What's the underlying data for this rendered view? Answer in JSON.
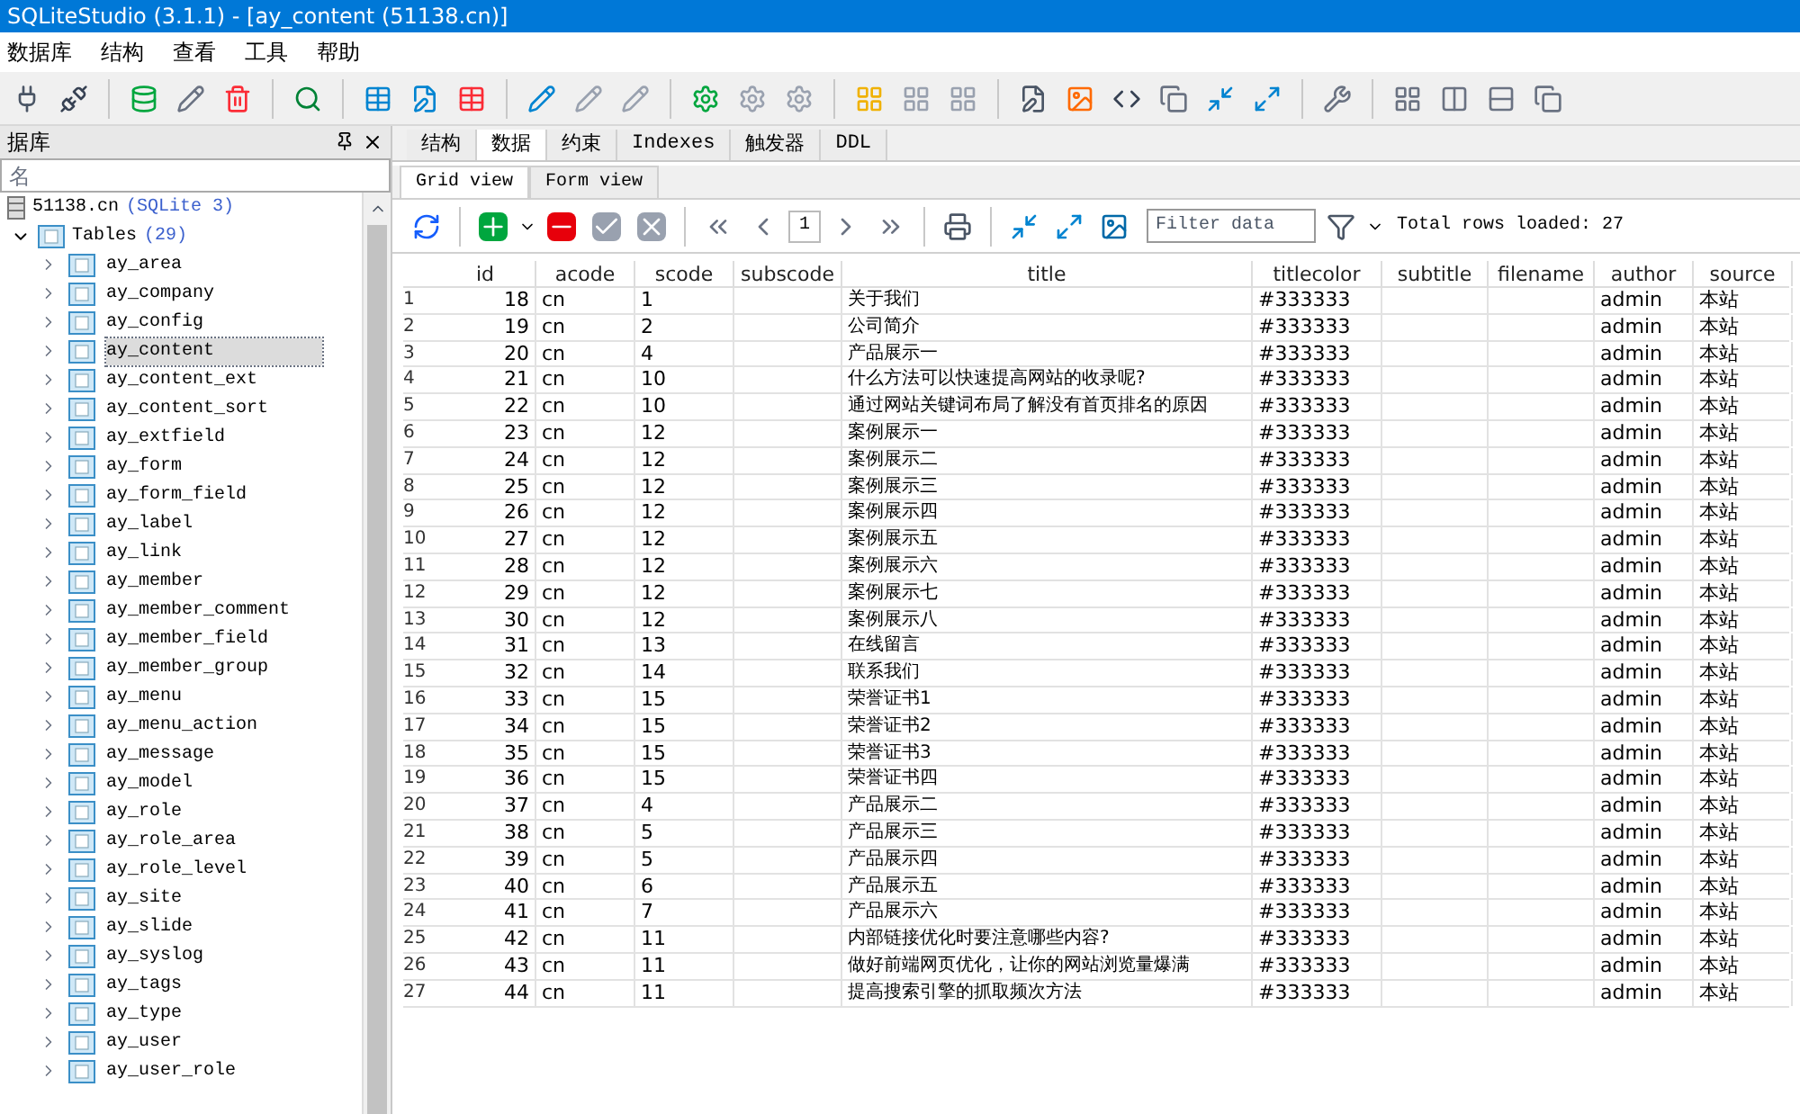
{
  "window": {
    "title": "SQLiteStudio (3.1.1) - [ay_content (51138.cn)]"
  },
  "menu": [
    "数据库",
    "结构",
    "查看",
    "工具",
    "帮助"
  ],
  "sidebar": {
    "title": "据库",
    "filter": {
      "placeholder": "名"
    },
    "database": {
      "name": "51138.cn",
      "type": "(SQLite 3)",
      "expanded": true
    },
    "tables": {
      "label": "Tables",
      "count": "(29)",
      "expanded": true,
      "items": [
        {
          "name": "ay_area",
          "selected": false
        },
        {
          "name": "ay_company",
          "selected": false
        },
        {
          "name": "ay_config",
          "selected": false
        },
        {
          "name": "ay_content",
          "selected": true
        },
        {
          "name": "ay_content_ext",
          "selected": false
        },
        {
          "name": "ay_content_sort",
          "selected": false
        },
        {
          "name": "ay_extfield",
          "selected": false
        },
        {
          "name": "ay_form",
          "selected": false
        },
        {
          "name": "ay_form_field",
          "selected": false
        },
        {
          "name": "ay_label",
          "selected": false
        },
        {
          "name": "ay_link",
          "selected": false
        },
        {
          "name": "ay_member",
          "selected": false
        },
        {
          "name": "ay_member_comment",
          "selected": false
        },
        {
          "name": "ay_member_field",
          "selected": false
        },
        {
          "name": "ay_member_group",
          "selected": false
        },
        {
          "name": "ay_menu",
          "selected": false
        },
        {
          "name": "ay_menu_action",
          "selected": false
        },
        {
          "name": "ay_message",
          "selected": false
        },
        {
          "name": "ay_model",
          "selected": false
        },
        {
          "name": "ay_role",
          "selected": false
        },
        {
          "name": "ay_role_area",
          "selected": false
        },
        {
          "name": "ay_role_level",
          "selected": false
        },
        {
          "name": "ay_site",
          "selected": false
        },
        {
          "name": "ay_slide",
          "selected": false
        },
        {
          "name": "ay_syslog",
          "selected": false
        },
        {
          "name": "ay_tags",
          "selected": false
        },
        {
          "name": "ay_type",
          "selected": false
        },
        {
          "name": "ay_user",
          "selected": false
        },
        {
          "name": "ay_user_role",
          "selected": false
        }
      ]
    }
  },
  "tabs": [
    {
      "label": "结构",
      "selected": false
    },
    {
      "label": "数据",
      "selected": true
    },
    {
      "label": "约束",
      "selected": false
    },
    {
      "label": "Indexes",
      "selected": false
    },
    {
      "label": "触发器",
      "selected": false
    },
    {
      "label": "DDL",
      "selected": false
    }
  ],
  "view_tabs": [
    {
      "label": "Grid view",
      "selected": true
    },
    {
      "label": "Form view",
      "selected": false
    }
  ],
  "data_toolbar": {
    "page": "1",
    "filter": {
      "placeholder": "Filter data"
    },
    "status": "Total rows loaded: 27"
  },
  "table": {
    "columns": [
      {
        "name": "id"
      },
      {
        "name": "acode"
      },
      {
        "name": "scode"
      },
      {
        "name": "subscode"
      },
      {
        "name": "title"
      },
      {
        "name": "titlecolor"
      },
      {
        "name": "subtitle"
      },
      {
        "name": "filename"
      },
      {
        "name": "author"
      },
      {
        "name": "source"
      }
    ],
    "rows": [
      {
        "num": "1",
        "cells": [
          "18",
          "cn",
          "1",
          "",
          "关于我们",
          "#333333",
          "",
          "",
          "admin",
          "本站"
        ]
      },
      {
        "num": "2",
        "cells": [
          "19",
          "cn",
          "2",
          "",
          "公司简介",
          "#333333",
          "",
          "",
          "admin",
          "本站"
        ]
      },
      {
        "num": "3",
        "cells": [
          "20",
          "cn",
          "4",
          "",
          "产品展示一",
          "#333333",
          "",
          "",
          "admin",
          "本站"
        ]
      },
      {
        "num": "4",
        "cells": [
          "21",
          "cn",
          "10",
          "",
          "什么方法可以快速提高网站的收录呢?",
          "#333333",
          "",
          "",
          "admin",
          "本站"
        ]
      },
      {
        "num": "5",
        "cells": [
          "22",
          "cn",
          "10",
          "",
          "通过网站关键词布局了解没有首页排名的原因",
          "#333333",
          "",
          "",
          "admin",
          "本站"
        ]
      },
      {
        "num": "6",
        "cells": [
          "23",
          "cn",
          "12",
          "",
          "案例展示一",
          "#333333",
          "",
          "",
          "admin",
          "本站"
        ]
      },
      {
        "num": "7",
        "cells": [
          "24",
          "cn",
          "12",
          "",
          "案例展示二",
          "#333333",
          "",
          "",
          "admin",
          "本站"
        ]
      },
      {
        "num": "8",
        "cells": [
          "25",
          "cn",
          "12",
          "",
          "案例展示三",
          "#333333",
          "",
          "",
          "admin",
          "本站"
        ]
      },
      {
        "num": "9",
        "cells": [
          "26",
          "cn",
          "12",
          "",
          "案例展示四",
          "#333333",
          "",
          "",
          "admin",
          "本站"
        ]
      },
      {
        "num": "10",
        "cells": [
          "27",
          "cn",
          "12",
          "",
          "案例展示五",
          "#333333",
          "",
          "",
          "admin",
          "本站"
        ]
      },
      {
        "num": "11",
        "cells": [
          "28",
          "cn",
          "12",
          "",
          "案例展示六",
          "#333333",
          "",
          "",
          "admin",
          "本站"
        ]
      },
      {
        "num": "12",
        "cells": [
          "29",
          "cn",
          "12",
          "",
          "案例展示七",
          "#333333",
          "",
          "",
          "admin",
          "本站"
        ]
      },
      {
        "num": "13",
        "cells": [
          "30",
          "cn",
          "12",
          "",
          "案例展示八",
          "#333333",
          "",
          "",
          "admin",
          "本站"
        ]
      },
      {
        "num": "14",
        "cells": [
          "31",
          "cn",
          "13",
          "",
          "在线留言",
          "#333333",
          "",
          "",
          "admin",
          "本站"
        ]
      },
      {
        "num": "15",
        "cells": [
          "32",
          "cn",
          "14",
          "",
          "联系我们",
          "#333333",
          "",
          "",
          "admin",
          "本站"
        ]
      },
      {
        "num": "16",
        "cells": [
          "33",
          "cn",
          "15",
          "",
          "荣誉证书1",
          "#333333",
          "",
          "",
          "admin",
          "本站"
        ]
      },
      {
        "num": "17",
        "cells": [
          "34",
          "cn",
          "15",
          "",
          "荣誉证书2",
          "#333333",
          "",
          "",
          "admin",
          "本站"
        ]
      },
      {
        "num": "18",
        "cells": [
          "35",
          "cn",
          "15",
          "",
          "荣誉证书3",
          "#333333",
          "",
          "",
          "admin",
          "本站"
        ]
      },
      {
        "num": "19",
        "cells": [
          "36",
          "cn",
          "15",
          "",
          "荣誉证书四",
          "#333333",
          "",
          "",
          "admin",
          "本站"
        ]
      },
      {
        "num": "20",
        "cells": [
          "37",
          "cn",
          "4",
          "",
          "产品展示二",
          "#333333",
          "",
          "",
          "admin",
          "本站"
        ]
      },
      {
        "num": "21",
        "cells": [
          "38",
          "cn",
          "5",
          "",
          "产品展示三",
          "#333333",
          "",
          "",
          "admin",
          "本站"
        ]
      },
      {
        "num": "22",
        "cells": [
          "39",
          "cn",
          "5",
          "",
          "产品展示四",
          "#333333",
          "",
          "",
          "admin",
          "本站"
        ]
      },
      {
        "num": "23",
        "cells": [
          "40",
          "cn",
          "6",
          "",
          "产品展示五",
          "#333333",
          "",
          "",
          "admin",
          "本站"
        ]
      },
      {
        "num": "24",
        "cells": [
          "41",
          "cn",
          "7",
          "",
          "产品展示六",
          "#333333",
          "",
          "",
          "admin",
          "本站"
        ]
      },
      {
        "num": "25",
        "cells": [
          "42",
          "cn",
          "11",
          "",
          "内部链接优化时要注意哪些内容?",
          "#333333",
          "",
          "",
          "admin",
          "本站"
        ]
      },
      {
        "num": "26",
        "cells": [
          "43",
          "cn",
          "11",
          "",
          "做好前端网页优化，让你的网站浏览量爆满",
          "#333333",
          "",
          "",
          "admin",
          "本站"
        ]
      },
      {
        "num": "27",
        "cells": [
          "44",
          "cn",
          "11",
          "",
          "提高搜索引擎的抓取频次方法",
          "#333333",
          "",
          "",
          "admin",
          "本站"
        ]
      }
    ]
  }
}
